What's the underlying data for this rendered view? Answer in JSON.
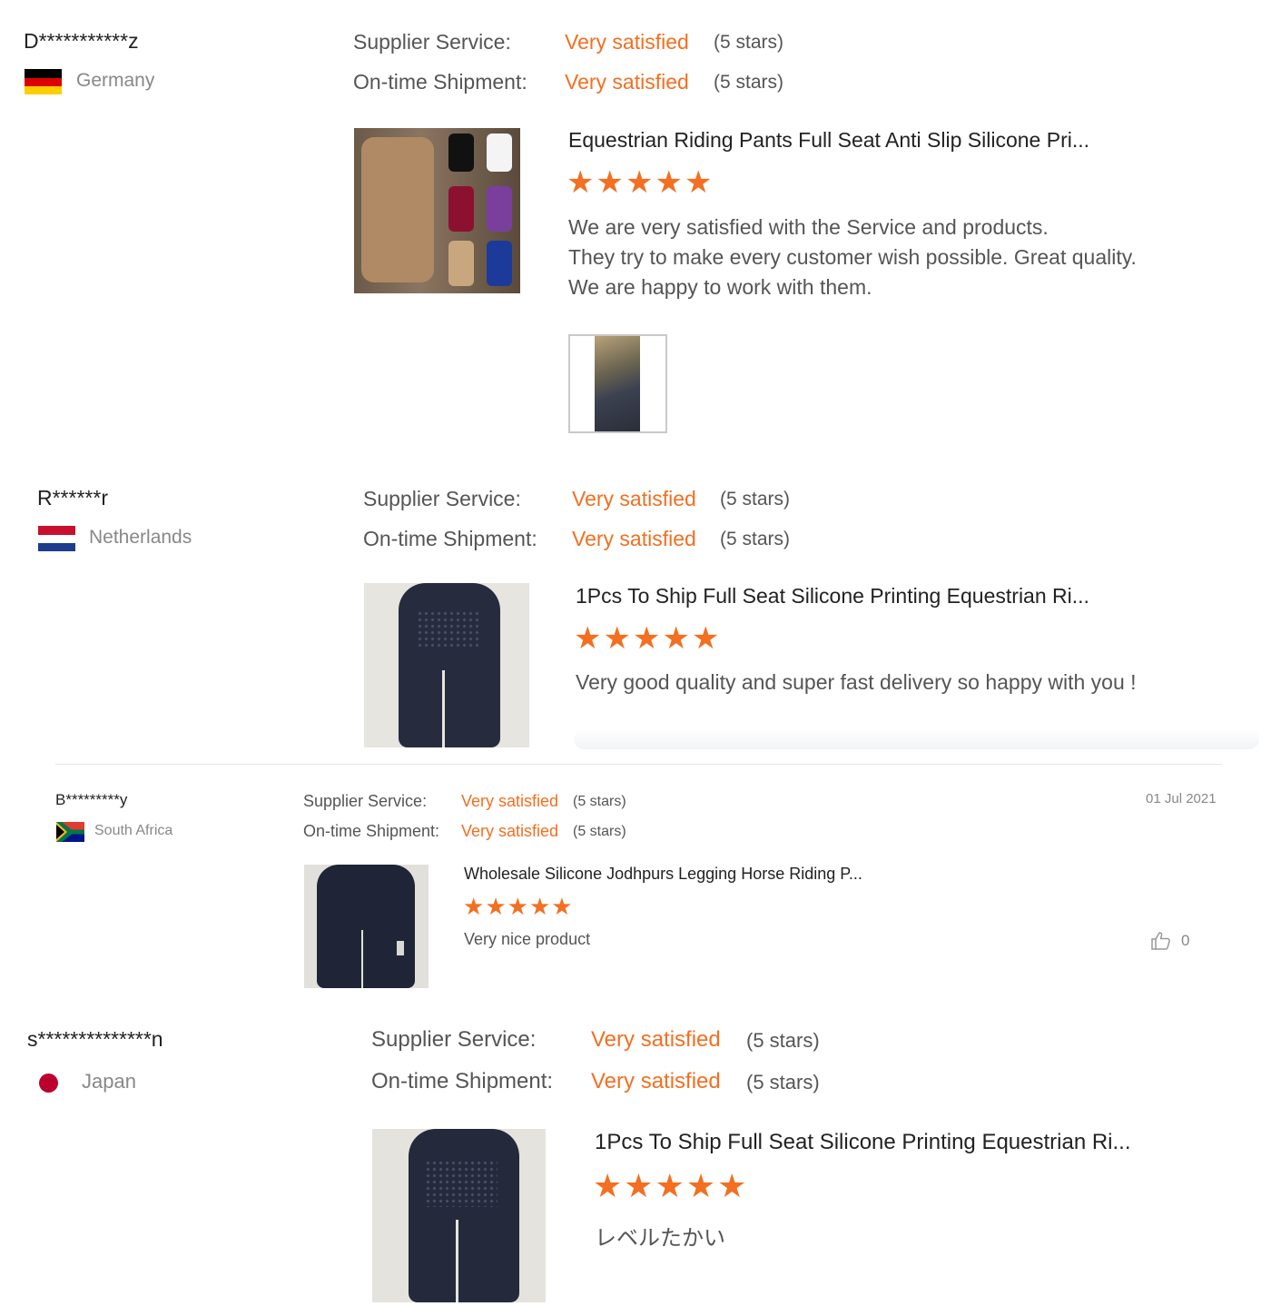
{
  "colors": {
    "accent": "#f36f21",
    "label": "#555555",
    "muted": "#888888"
  },
  "reviews": [
    {
      "user": "D***********z",
      "country": "Germany",
      "flag": "de-flag",
      "supplier_label": "Supplier Service:",
      "supplier_value": "Very satisfied",
      "supplier_stars": "(5 stars)",
      "shipment_label": "On-time Shipment:",
      "shipment_value": "Very satisfied",
      "shipment_stars": "(5 stars)",
      "product_title": "Equestrian Riding Pants Full Seat Anti Slip Silicone Pri...",
      "rating": 5,
      "text_lines": [
        "We are very satisfied with the Service and products.",
        "They try to make every customer wish possible. Great quality.",
        "We are happy to work with them."
      ]
    },
    {
      "user": "R******r",
      "country": "Netherlands",
      "flag": "nl-flag",
      "supplier_label": "Supplier Service:",
      "supplier_value": "Very satisfied",
      "supplier_stars": "(5 stars)",
      "shipment_label": "On-time Shipment:",
      "shipment_value": "Very satisfied",
      "shipment_stars": "(5 stars)",
      "product_title": "1Pcs To Ship Full Seat Silicone Printing Equestrian Ri...",
      "rating": 5,
      "text": "Very good quality and super fast delivery so happy with you !"
    },
    {
      "user": "B*********y",
      "country": "South Africa",
      "flag": "za-flag",
      "supplier_label": "Supplier Service:",
      "supplier_value": "Very satisfied",
      "supplier_stars": "(5 stars)",
      "shipment_label": "On-time Shipment:",
      "shipment_value": "Very satisfied",
      "shipment_stars": "(5 stars)",
      "date": "01 Jul 2021",
      "product_title": "Wholesale Silicone Jodhpurs Legging Horse Riding P...",
      "rating": 5,
      "text": "Very nice product",
      "likes": "0"
    },
    {
      "user": "s**************n",
      "country": "Japan",
      "flag": "jp-flag",
      "supplier_label": "Supplier Service:",
      "supplier_value": "Very satisfied",
      "supplier_stars": "(5 stars)",
      "shipment_label": "On-time Shipment:",
      "shipment_value": "Very satisfied",
      "shipment_stars": "(5 stars)",
      "product_title": "1Pcs To Ship Full Seat Silicone Printing Equestrian Ri...",
      "rating": 5,
      "text": "レベルたかい"
    }
  ]
}
